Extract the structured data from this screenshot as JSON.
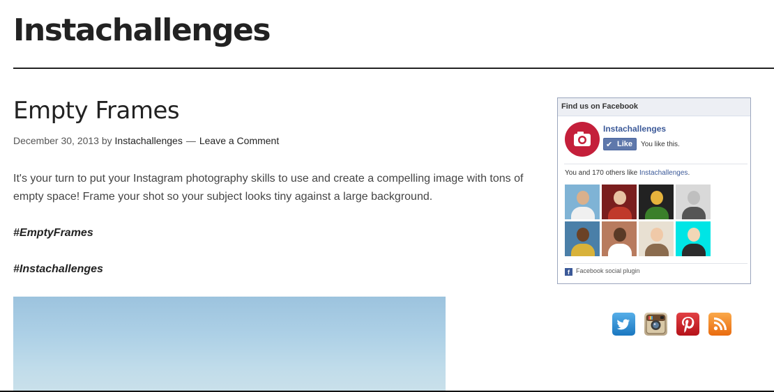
{
  "site": {
    "title": "Instachallenges"
  },
  "post": {
    "title": "Empty Frames",
    "date": "December 30, 2013",
    "by": "by",
    "author": "Instachallenges",
    "separator": "—",
    "comment_link": "Leave a Comment",
    "intro": "It's your turn to put your  Instagram photography skills to use and create a compelling image with tons of empty space! Frame your shot so your subject looks tiny against a large background.",
    "tags": [
      "#EmptyFrames",
      "#Instachallenges"
    ]
  },
  "facebook_widget": {
    "header": "Find us on Facebook",
    "page_name": "Instachallenges",
    "like_button": "Like",
    "you_like": "You like this.",
    "count_prefix": "You and 170 others like",
    "count_page": "Instachallenges",
    "count_suffix": ".",
    "footer": "Facebook social plugin",
    "fb_glyph": "f",
    "faces": [
      {
        "bg": "#7fb3d5",
        "skin": "#d9b08c",
        "shirt": "#f0f0f0"
      },
      {
        "bg": "#7a1e1e",
        "skin": "#e8c3a4",
        "shirt": "#c0392b"
      },
      {
        "bg": "#222222",
        "skin": "#e6b33c",
        "shirt": "#3a7f2a"
      },
      {
        "bg": "#d9d9d9",
        "skin": "#bfbfbf",
        "shirt": "#555555"
      },
      {
        "bg": "#4a7fa8",
        "skin": "#6b4226",
        "shirt": "#d8b23a"
      },
      {
        "bg": "#b87b5e",
        "skin": "#5a3a26",
        "shirt": "#ffffff"
      },
      {
        "bg": "#e8e0d2",
        "skin": "#f0c9a8",
        "shirt": "#8a6b4e"
      },
      {
        "bg": "#00e5e5",
        "skin": "#f2d7b6",
        "shirt": "#2c2c2c"
      }
    ]
  },
  "social_icons": [
    {
      "name": "twitter-icon",
      "color": "#2b8fd6"
    },
    {
      "name": "instagram-icon",
      "color": "#b8a586"
    },
    {
      "name": "pinterest-icon",
      "color": "#cb2027"
    },
    {
      "name": "rss-icon",
      "color": "#f58a25"
    }
  ]
}
